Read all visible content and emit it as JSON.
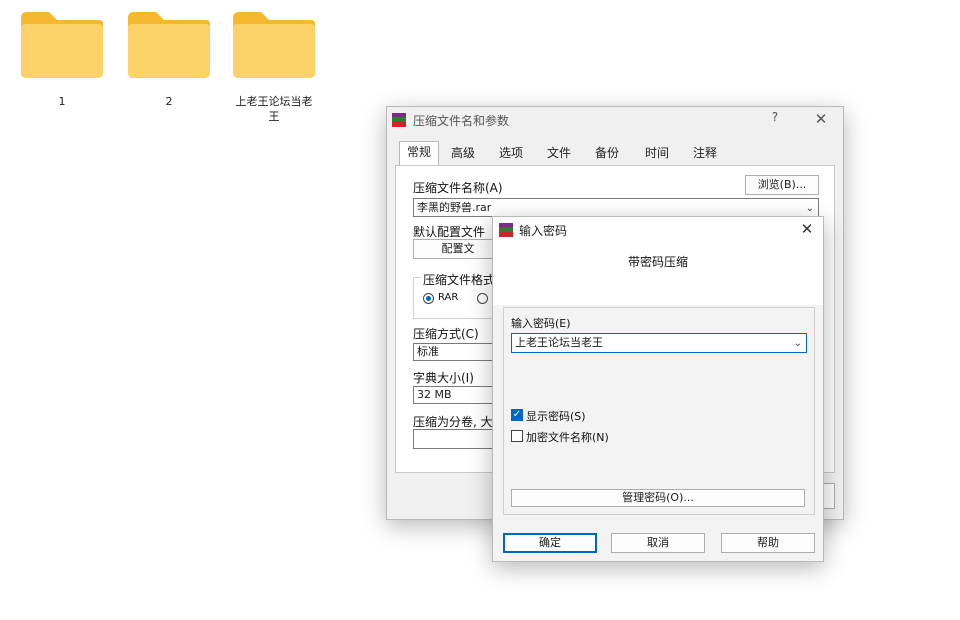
{
  "desktop": {
    "folders": [
      {
        "label": "1"
      },
      {
        "label": "2"
      },
      {
        "label": "上老王论坛当老王"
      }
    ],
    "folder_color": "#f8c94e"
  },
  "archive_dialog": {
    "title": "压缩文件名和参数",
    "help": "?",
    "close": "✕",
    "tabs": [
      "常规",
      "高级",
      "选项",
      "文件",
      "备份",
      "时间",
      "注释"
    ],
    "archive_name_label": "压缩文件名称(A)",
    "browse_button": "浏览(B)...",
    "archive_name_value": "李黑的野兽.rar",
    "default_profile_label": "默认配置文件",
    "profile_button": "配置文",
    "format_label": "压缩文件格式",
    "format_rar": "RAR",
    "method_label": "压缩方式(C)",
    "method_value": "标准",
    "dict_label": "字典大小(I)",
    "dict_value": "32 MB",
    "split_label": "压缩为分卷, 大"
  },
  "password_dialog": {
    "title": "输入密码",
    "close": "✕",
    "heading": "带密码压缩",
    "password_label": "输入密码(E)",
    "password_value": "上老王论坛当老王",
    "show_password_label": "显示密码(S)",
    "encrypt_names_label": "加密文件名称(N)",
    "show_password_checked": true,
    "encrypt_names_checked": false,
    "manage_button": "管理密码(O)...",
    "ok_button": "确定",
    "cancel_button": "取消",
    "help_button": "帮助"
  },
  "colors": {
    "accent": "#0067c0",
    "window_bg": "#f0f0f0"
  }
}
